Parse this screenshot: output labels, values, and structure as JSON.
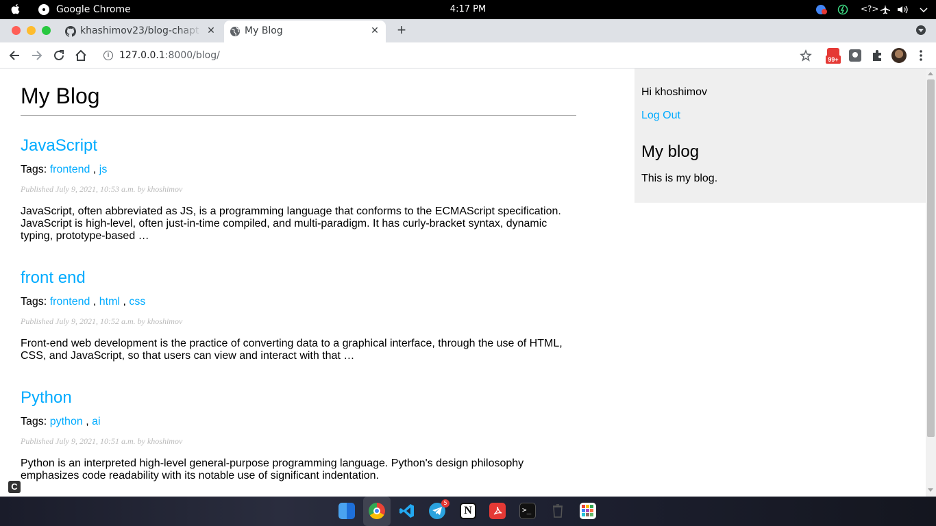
{
  "system_bar": {
    "app_name": "Google Chrome",
    "clock": "4:17 PM"
  },
  "tabs": [
    {
      "title": "khashimov23/blog-chapt",
      "favicon": "github-icon",
      "active": false
    },
    {
      "title": "My Blog",
      "favicon": "globe-icon",
      "active": true
    }
  ],
  "toolbar": {
    "url_host": "127.0.0.1",
    "url_path": ":8000/blog/",
    "extension_badge": "99+"
  },
  "page": {
    "blog_title": "My Blog",
    "posts": [
      {
        "title": "JavaScript",
        "tags_label": "Tags:",
        "tags": [
          "frontend",
          "js"
        ],
        "published": "Published July 9, 2021, 10:53 a.m. by khoshimov",
        "body": "JavaScript, often abbreviated as JS, is a programming language that conforms to the ECMAScript specification. JavaScript is high-level, often just-in-time compiled, and multi-paradigm. It has curly-bracket syntax, dynamic typing, prototype-based …"
      },
      {
        "title": "front end",
        "tags_label": "Tags:",
        "tags": [
          "frontend",
          "html",
          "css"
        ],
        "published": "Published July 9, 2021, 10:52 a.m. by khoshimov",
        "body": "Front-end web development is the practice of converting data to a graphical interface, through the use of HTML, CSS, and JavaScript, so that users can view and interact with that …"
      },
      {
        "title": "Python",
        "tags_label": "Tags:",
        "tags": [
          "python",
          "ai"
        ],
        "published": "Published July 9, 2021, 10:51 a.m. by khoshimov",
        "body": "Python is an interpreted high-level general-purpose programming language. Python's design philosophy emphasizes code readability with its notable use of significant indentation."
      }
    ],
    "sidebar": {
      "greeting": "Hi khoshimov",
      "logout_label": "Log Out",
      "title": "My blog",
      "description": "This is my blog."
    }
  },
  "dock": {
    "telegram_badge": "5",
    "items": [
      "finder-icon",
      "chrome-icon",
      "vscode-icon",
      "telegram-icon",
      "notion-icon",
      "pdf-icon",
      "terminal-icon",
      "trash-icon",
      "app-grid-icon"
    ]
  },
  "colors": {
    "link": "#00abff",
    "sidebar_bg": "#efefef"
  }
}
